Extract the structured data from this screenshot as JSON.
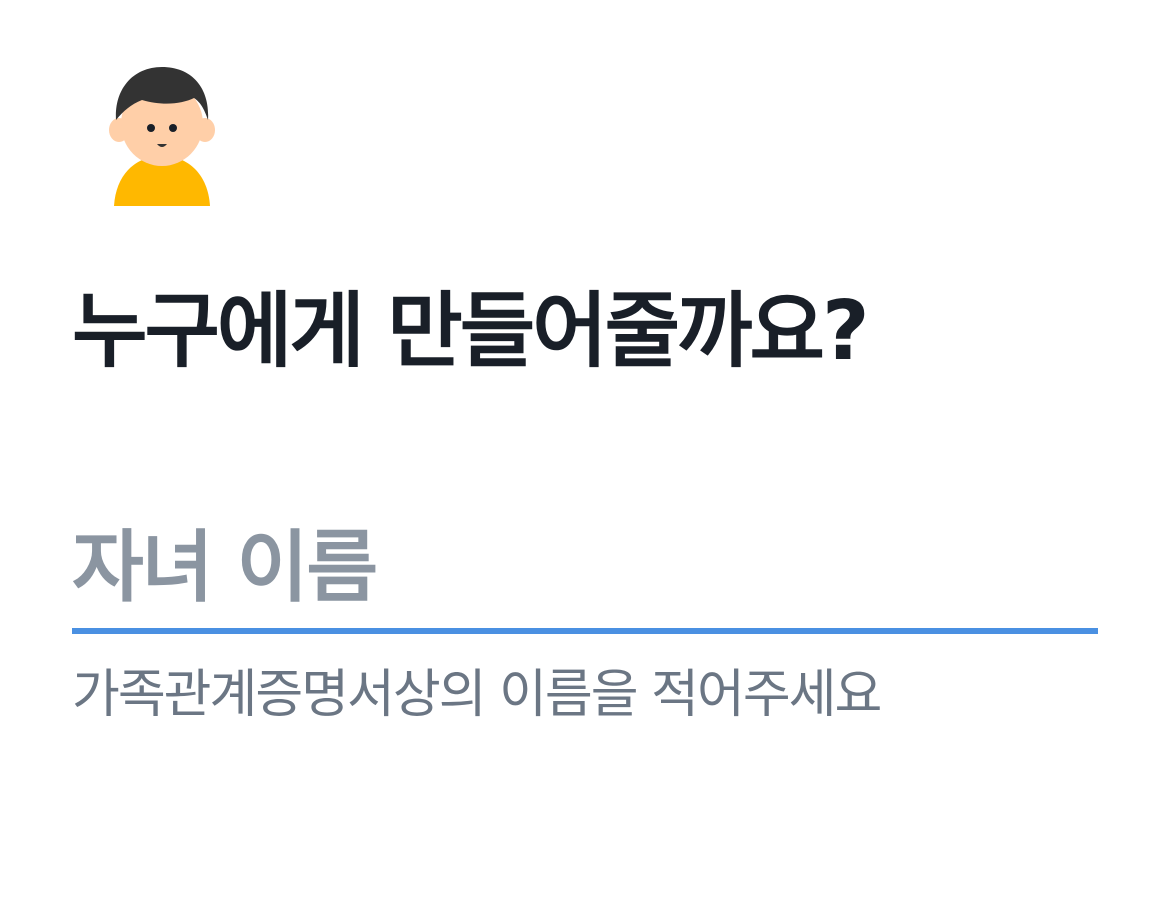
{
  "header": {
    "avatar_icon": "child-avatar-icon",
    "title": "누구에게 만들어줄까요?"
  },
  "form": {
    "child_name": {
      "placeholder": "자녀 이름",
      "value": "",
      "helper": "가족관계증명서상의 이름을 적어주세요"
    }
  },
  "colors": {
    "title": "#191f28",
    "placeholder": "#8b95a1",
    "helper": "#6b7684",
    "accent_underline": "#4a90e2",
    "avatar_hair": "#333333",
    "avatar_skin": "#ffcfa8",
    "avatar_shirt": "#ffb800",
    "background": "#ffffff"
  }
}
